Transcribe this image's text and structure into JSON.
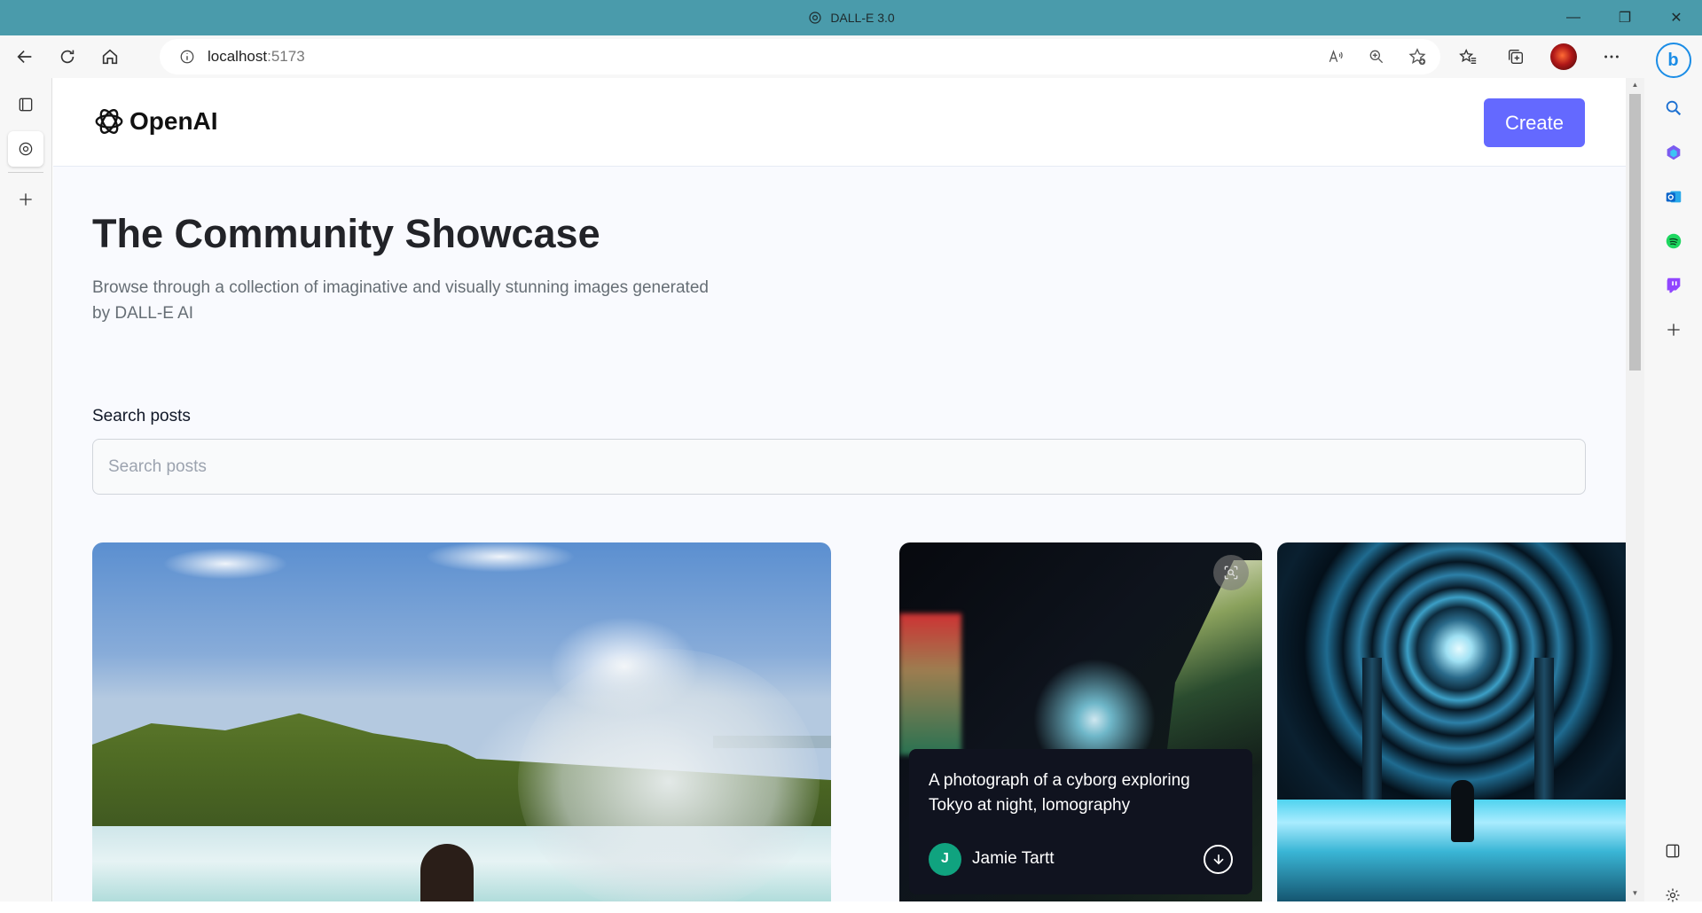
{
  "browser": {
    "window_title": "DALL-E 3.0",
    "url_host": "localhost",
    "url_port": ":5173"
  },
  "app": {
    "logo_text": "OpenAI",
    "create_label": "Create",
    "accent_color": "#6469ff"
  },
  "hero": {
    "title": "The Community Showcase",
    "subtitle": "Browse through a collection of imaginative and visually stunning images generated by DALL-E AI"
  },
  "search": {
    "label": "Search posts",
    "placeholder": "Search posts",
    "value": ""
  },
  "posts": [
    {
      "image_subject": "waterfall-scene"
    },
    {
      "image_subject": "cyborg-tokyo-night",
      "prompt": "A photograph of a cyborg exploring Tokyo at night, lomography",
      "author_initial": "J",
      "author_name": "Jamie Tartt"
    },
    {
      "image_subject": "cosmic-portal"
    }
  ]
}
